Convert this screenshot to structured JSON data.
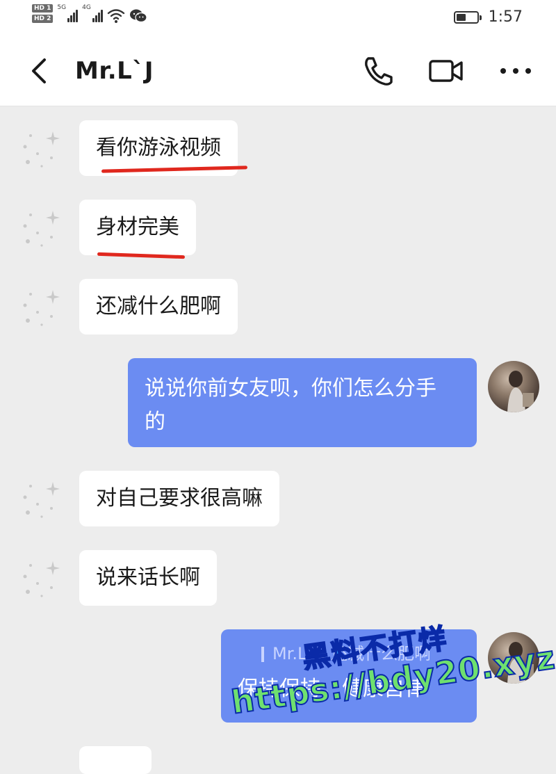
{
  "status_bar": {
    "hd1": "HD 1",
    "hd2": "HD 2",
    "net1": "5G",
    "net2": "4G",
    "time": "1:57",
    "battery_level": 0.45,
    "icons": [
      "signal-icon",
      "wifi-icon",
      "wechat-icon",
      "battery-icon"
    ]
  },
  "header": {
    "title": "Mr.L`J",
    "icons": [
      "back-icon",
      "phone-icon",
      "video-icon",
      "more-icon"
    ]
  },
  "messages": [
    {
      "from": "other",
      "text": "看你游泳视频",
      "underlined": true
    },
    {
      "from": "other",
      "text": "身材完美",
      "underlined": true
    },
    {
      "from": "other",
      "text": "还减什么肥啊"
    },
    {
      "from": "self",
      "line1": "说说你前女友呗，你们怎么分手",
      "line2": "的"
    },
    {
      "from": "other",
      "text": "对自己要求很高嘛"
    },
    {
      "from": "other",
      "text": "说来话长啊"
    },
    {
      "from": "self",
      "quote": "Mr.L`J: 还减什么肥啊",
      "text": "保持保持，健康自律"
    }
  ],
  "watermark": {
    "line1": "黑料不打烊",
    "line2": "https://bdy20.xyz"
  },
  "colors": {
    "outgoing_bubble": "#6b8cf2",
    "incoming_bubble": "#ffffff",
    "background": "#ededed",
    "underline": "#e0281e"
  }
}
